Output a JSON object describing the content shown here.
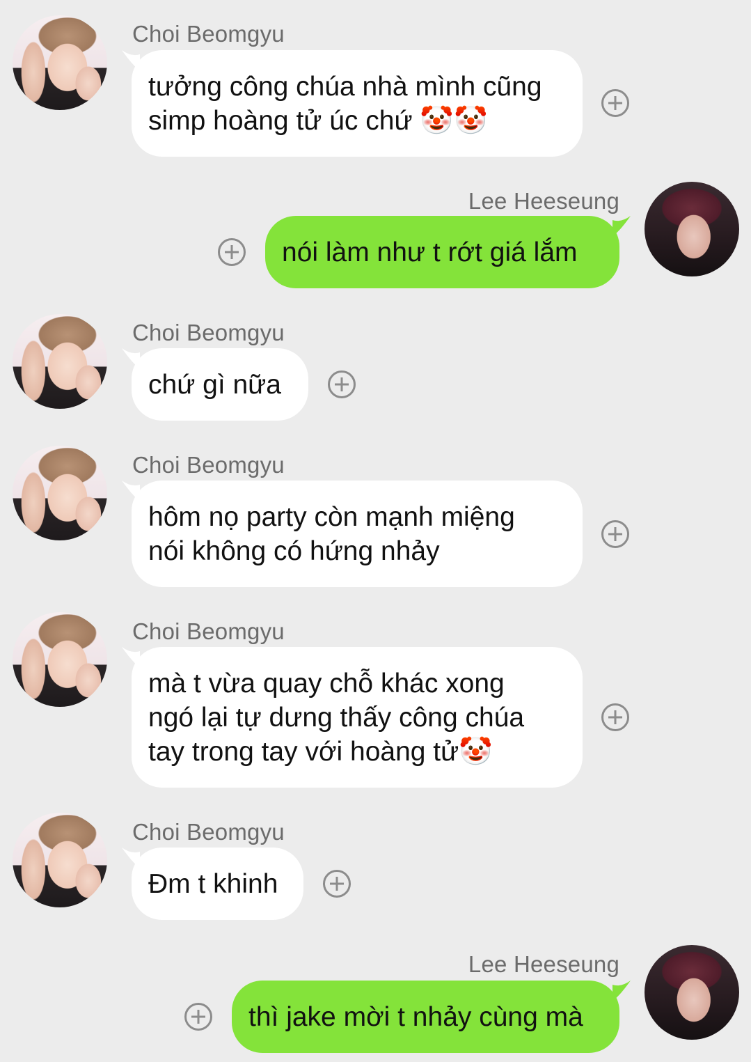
{
  "messages": [
    {
      "sender": "Choi Beomgyu",
      "side": "left",
      "lines": [
        "tưởng công chúa nhà mình cũng",
        "simp hoàng tử úc chứ 🤡🤡"
      ]
    },
    {
      "sender": "Lee Heeseung",
      "side": "right",
      "lines": [
        "nói làm như t rớt giá lắm"
      ]
    },
    {
      "sender": "Choi Beomgyu",
      "side": "left",
      "lines": [
        "chứ gì nữa"
      ]
    },
    {
      "sender": "Choi Beomgyu",
      "side": "left",
      "lines": [
        "hôm nọ party còn mạnh miệng",
        "nói không có hứng nhảy"
      ]
    },
    {
      "sender": "Choi Beomgyu",
      "side": "left",
      "lines": [
        "mà t vừa quay chỗ khác xong",
        "ngó lại tự dưng thấy công chúa",
        "tay trong tay với hoàng tử🤡"
      ]
    },
    {
      "sender": "Choi Beomgyu",
      "side": "left",
      "lines": [
        "Đm t khinh"
      ]
    },
    {
      "sender": "Lee Heeseung",
      "side": "right",
      "lines": [
        "thì jake mời t nhảy cùng mà"
      ]
    }
  ],
  "colors": {
    "background": "#ececec",
    "incoming_bubble": "#ffffff",
    "outgoing_bubble": "#84e33a",
    "name_text": "#6b6b6b"
  },
  "icons": {
    "react_button": "plus-circle-icon"
  }
}
